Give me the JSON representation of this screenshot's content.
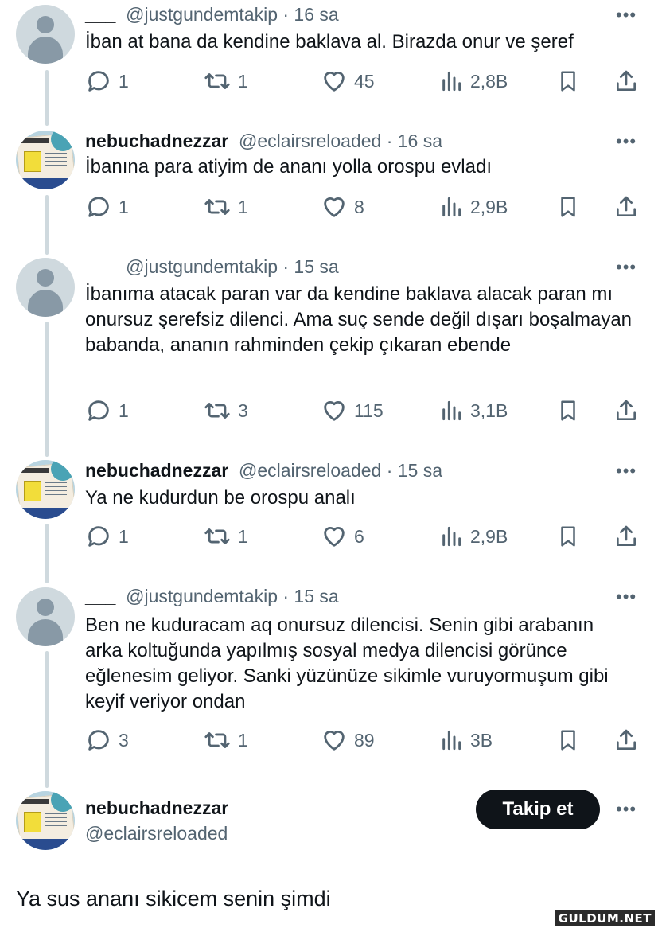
{
  "tweets": [
    {
      "name": "___",
      "handle": "@justgundemtakip · 16 sa",
      "text": "İban at bana da kendine baklava al. Birazda onur ve şeref",
      "replies": "1",
      "reposts": "1",
      "likes": "45",
      "views": "2,8B"
    },
    {
      "name": "nebuchadnezzar",
      "handle": "@eclairsreloaded · 16 sa",
      "text": "İbanına para atiyim de ananı yolla orospu evladı",
      "replies": "1",
      "reposts": "1",
      "likes": "8",
      "views": "2,9B"
    },
    {
      "name": "___",
      "handle": "@justgundemtakip · 15 sa",
      "text": "İbanıma atacak paran var da kendine baklava alacak paran mı onursuz şerefsiz dilenci. Ama suç sende değil dışarı boşalmayan babanda, ananın rahminden çekip çıkaran ebende",
      "replies": "1",
      "reposts": "3",
      "likes": "115",
      "views": "3,1B"
    },
    {
      "name": "nebuchadnezzar",
      "handle": "@eclairsreloaded · 15 sa",
      "text": "Ya ne kudurdun be orospu analı",
      "replies": "1",
      "reposts": "1",
      "likes": "6",
      "views": "2,9B"
    },
    {
      "name": "___",
      "handle": "@justgundemtakip · 15 sa",
      "text": "Ben ne kuduracam aq onursuz dilencisi. Senin gibi arabanın arka koltuğunda yapılmış sosyal medya dilencisi görünce eğlenesim geliyor. Sanki yüzünüze sikimle vuruyormuşum gibi keyif veriyor ondan",
      "replies": "3",
      "reposts": "1",
      "likes": "89",
      "views": "3B"
    }
  ],
  "main_tweet": {
    "name": "nebuchadnezzar",
    "handle": "@eclairsreloaded",
    "follow_label": "Takip et",
    "text": "Ya sus ananı sikicem senin şimdi"
  },
  "more_icon": "•••",
  "watermark": "GULDUM.NET",
  "icons": [
    "reply-icon",
    "repost-icon",
    "like-icon",
    "views-icon",
    "bookmark-icon",
    "share-icon",
    "more-icon",
    "default-avatar-icon"
  ],
  "colors": {
    "text": "#0f1419",
    "secondary": "#536471",
    "thread_line": "#cfd9de",
    "button": "#0f1419"
  }
}
